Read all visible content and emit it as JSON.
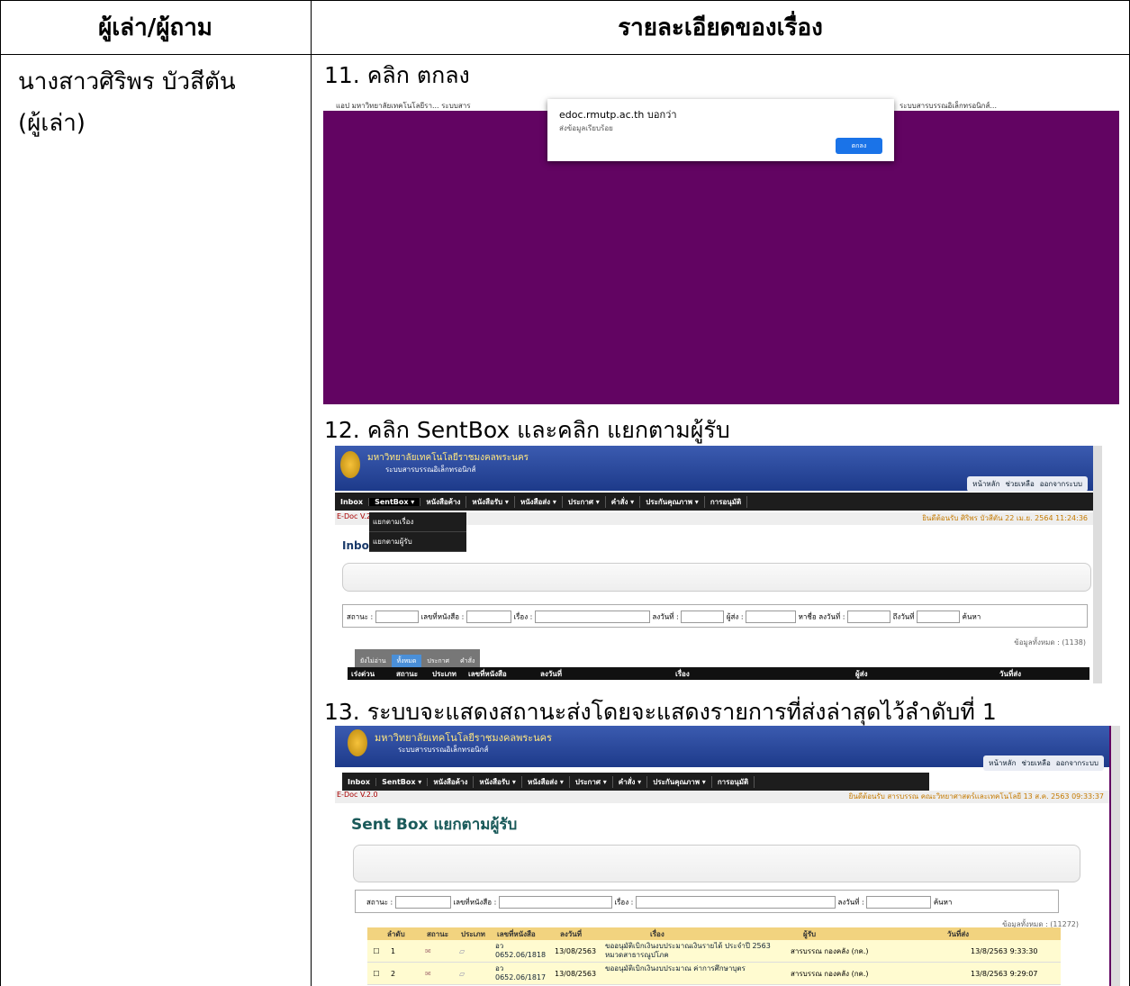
{
  "header": {
    "col1": "ผู้เล่า/ผู้ถาม",
    "col2": "รายละเอียดของเรื่อง"
  },
  "narrator": {
    "name": "นางสาวศิริพร  บัวสีตัน",
    "role": "(ผู้เล่า)"
  },
  "steps": [
    "11. คลิก ตกลง",
    "12. คลิก SentBox และคลิก แยกตามผู้รับ",
    "13. ระบบจะแสดงสถานะส่งโดยจะแสดงรายการที่ส่งล่าสุดไว้ลำดับที่ 1"
  ],
  "shot1": {
    "bookmarks": "แอป   มหาวิทยาลัยเทคโนโลยีรา...   ระบบสาร",
    "bookmarks_right": "ระบบสารบรรณอิเล็กทรอนิกส์...",
    "dialog_title": "edoc.rmutp.ac.th บอกว่า",
    "dialog_msg": "ส่งข้อมูลเรียบร้อย",
    "dialog_ok": "ตกลง"
  },
  "edoc": {
    "university": "มหาวิทยาลัยเทคโนโลยีราชมงคลพระนคร",
    "system": "ระบบสารบรรณอิเล็กทรอนิกส์",
    "links": [
      "หน้าหลัก",
      "ช่วยเหลือ",
      "ออกจากระบบ"
    ],
    "menu": [
      "Inbox",
      "SentBox ▾",
      "หนังสือค้าง",
      "หนังสือรับ ▾",
      "หนังสือส่ง ▾",
      "ประกาศ ▾",
      "คำสั่ง ▾",
      "ประกันคุณภาพ ▾",
      "การอนุมัติ"
    ],
    "version": "E-Doc V.2.0",
    "shot2": {
      "welcome": "ยินดีต้อนรับ ศิริพร บัวสีตัน 22 เม.ย. 2564 11:24:36",
      "dropdown": [
        "แยกตามเรื่อง",
        "แยกตามผู้รับ"
      ],
      "title": "Inbox",
      "filter": {
        "status": "สถานะ :",
        "docno": "เลขที่หนังสือ :",
        "subject": "เรื่อง :",
        "date": "ลงวันที่ :",
        "sender": "ผู้ส่ง :",
        "find_name": "หาชื่อ",
        "date2": "ลงวันที่ :",
        "to_date": "ถึงวันที่",
        "search": "ค้นหา"
      },
      "total": "ข้อมูลทั้งหมด : (1138)",
      "tabs": [
        "ยังไม่อ่าน",
        "ทั้งหมด",
        "ประกาศ",
        "คำสั่ง"
      ],
      "columns": [
        "เร่งด่วน",
        "สถานะ",
        "ประเภท",
        "เลขที่หนังสือ",
        "ลงวันที่",
        "เรื่อง",
        "ผู้ส่ง",
        "วันที่ส่ง"
      ]
    },
    "shot3": {
      "welcome": "ยินดีต้อนรับ สารบรรณ คณะวิทยาศาสตร์และเทคโนโลยี 13 ส.ค. 2563 09:33:37",
      "title": "Sent Box แยกตามผู้รับ",
      "filter": {
        "status": "สถานะ :",
        "docno": "เลขที่หนังสือ :",
        "subject": "เรื่อง :",
        "date": "ลงวันที่ :",
        "search": "ค้นหา"
      },
      "total": "ข้อมูลทั้งหมด : (11272)",
      "columns": [
        "ลำดับ",
        "สถานะ",
        "ประเภท",
        "เลขที่หนังสือ",
        "ลงวันที่",
        "เรื่อง",
        "ผู้รับ",
        "วันที่ส่ง"
      ],
      "rows": [
        {
          "no": "1",
          "docno": "อว 0652.06/1818",
          "date": "13/08/2563",
          "subject": "ขออนุมัติเบิกเงินงบประมาณเงินรายได้ ประจำปี 2563 หมวดสาธารณูปโภค",
          "receiver": "สารบรรณ กองคลัง (กค.)",
          "sent": "13/8/2563 9:33:30"
        },
        {
          "no": "2",
          "docno": "อว 0652.06/1817",
          "date": "13/08/2563",
          "subject": "ขออนุมัติเบิกเงินงบประมาณ ค่าการศึกษาบุตร",
          "receiver": "สารบรรณ กองคลัง (กค.)",
          "sent": "13/8/2563 9:29:07"
        }
      ]
    }
  }
}
